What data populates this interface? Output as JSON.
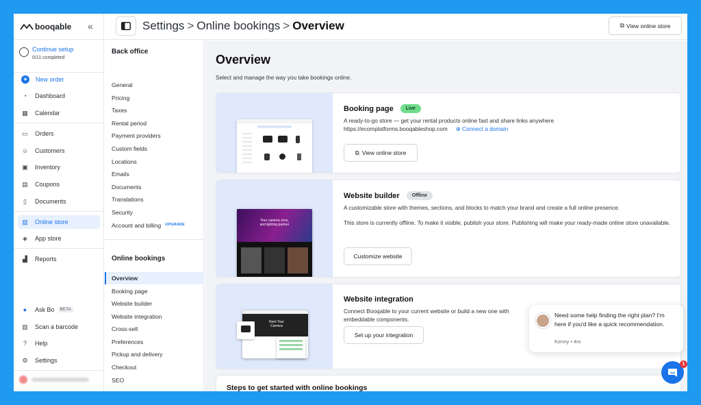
{
  "app": {
    "logo_text": "booqable",
    "collapse_icon": "double-chevron-left-icon"
  },
  "setup": {
    "title": "Continue setup",
    "progress": "0/11 completed"
  },
  "nav": {
    "new_order": "New order",
    "items": [
      {
        "label": "Dashboard",
        "icon": "gauge-icon"
      },
      {
        "label": "Calendar",
        "icon": "calendar-icon"
      },
      {
        "label": "Orders",
        "icon": "inbox-icon"
      },
      {
        "label": "Customers",
        "icon": "user-icon"
      },
      {
        "label": "Inventory",
        "icon": "box-icon"
      },
      {
        "label": "Coupons",
        "icon": "ticket-icon"
      },
      {
        "label": "Documents",
        "icon": "document-icon"
      },
      {
        "label": "Online store",
        "icon": "store-icon"
      },
      {
        "label": "App store",
        "icon": "apps-icon"
      },
      {
        "label": "Reports",
        "icon": "chart-icon"
      }
    ],
    "bottom": [
      {
        "label": "Ask Bo",
        "icon": "globe-icon",
        "badge": "BETA"
      },
      {
        "label": "Scan a barcode",
        "icon": "barcode-icon"
      },
      {
        "label": "Help",
        "icon": "help-icon"
      },
      {
        "label": "Settings",
        "icon": "gear-icon"
      }
    ]
  },
  "header": {
    "crumb1": "Settings",
    "crumb2": "Online bookings",
    "crumb3": "Overview",
    "separator": ">",
    "view_store": "View online store"
  },
  "subnav": {
    "back_office_title": "Back office",
    "back_office": [
      "General",
      "Pricing",
      "Taxes",
      "Rental period",
      "Payment providers",
      "Custom fields",
      "Locations",
      "Emails",
      "Documents",
      "Translations",
      "Security",
      "Account and billing"
    ],
    "upgrade_label": "UPGRADE",
    "online_title": "Online bookings",
    "online": [
      "Overview",
      "Booking page",
      "Website builder",
      "Website integration",
      "Cross-sell",
      "Preferences",
      "Pickup and delivery",
      "Checkout",
      "SEO"
    ]
  },
  "main": {
    "title": "Overview",
    "subtitle": "Select and manage the way you take bookings online.",
    "booking": {
      "title": "Booking page",
      "status": "Live",
      "desc": "A ready-to-go store — get your rental products online fast and share links anywhere",
      "url": "https://ecomplatforms.booqableshop.com",
      "connect": "Connect a domain",
      "button": "View online store"
    },
    "builder": {
      "title": "Website builder",
      "status": "Offline",
      "desc": "A customizable store with themes, sections, and blocks to match your brand and create a full online presence.",
      "desc2": "This store is currently offline. To make it visible, publish your store. Publishing will make your ready-made online store unavailable.",
      "button": "Customize website",
      "mock_heading": "Your camera, lens, and lighting partner"
    },
    "integration": {
      "title": "Website integration",
      "desc": "Connect Booqable to your current website or build a new one with",
      "desc2": "embeddable components.",
      "button": "Set up your integration",
      "mock_heading": "Rent Your Camera"
    },
    "steps_title": "Steps to get started with online bookings"
  },
  "chat": {
    "message": "Need some help finding the right plan? I'm here if you'd like a quick recommendation.",
    "meta": "Kenny • 4m",
    "badge": "1"
  },
  "colors": {
    "accent": "#1a73e8",
    "frame": "#1e9bf0",
    "live": "#6fdc8c"
  }
}
